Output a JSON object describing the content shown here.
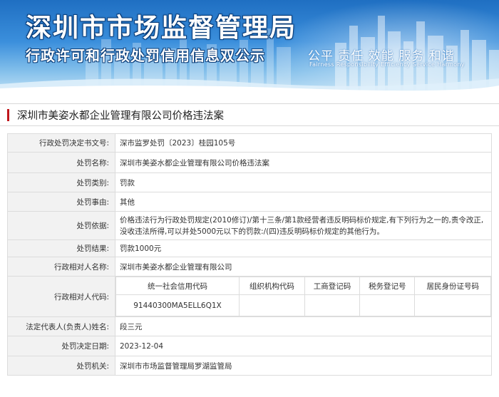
{
  "banner": {
    "title": "深圳市市场监督管理局",
    "subtitle": "行政许可和行政处罚信用信息双公示",
    "slogan": "公平  责任  效能  服务  和谐",
    "slogan_en": "Fairness  Responsibility  Efficiency  Service  Harmony"
  },
  "heading": "深圳市美姿水都企业管理有限公司价格违法案",
  "rows": [
    {
      "label": "行政处罚决定书文号:",
      "value": "深市监罗处罚〔2023〕桂园105号"
    },
    {
      "label": "处罚名称:",
      "value": "深圳市美姿水都企业管理有限公司价格违法案"
    },
    {
      "label": "处罚类别:",
      "value": "罚款"
    },
    {
      "label": "处罚事由:",
      "value": "其他"
    },
    {
      "label": "处罚依据:",
      "value": "价格违法行为行政处罚规定(2010修订)/第十三条/第1款经营者违反明码标价规定,有下列行为之一的,责令改正,没收违法所得,可以并处5000元以下的罚款:/(四)违反明码标价规定的其他行为。"
    },
    {
      "label": "处罚结果:",
      "value": "罚款1000元"
    },
    {
      "label": "行政相对人名称:",
      "value": "深圳市美姿水都企业管理有限公司"
    }
  ],
  "code_row": {
    "label": "行政相对人代码:",
    "headers": [
      "统一社会信用代码",
      "组织机构代码",
      "工商登记码",
      "税务登记号",
      "居民身份证号码"
    ],
    "values": [
      "91440300MA5ELL6Q1X",
      "",
      "",
      "",
      ""
    ]
  },
  "rows2": [
    {
      "label": "法定代表人(负责人)姓名:",
      "value": "段三元"
    },
    {
      "label": "处罚决定日期:",
      "value": "2023-12-04"
    },
    {
      "label": "处罚机关:",
      "value": "深圳市市场监督管理局罗湖监管局"
    }
  ]
}
